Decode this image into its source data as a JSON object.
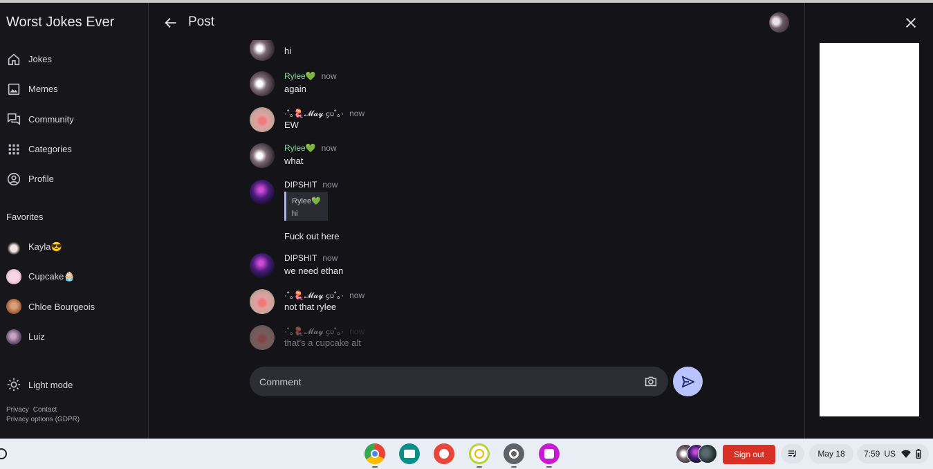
{
  "app_title": "Worst Jokes Ever",
  "nav": [
    {
      "label": "Jokes",
      "icon": "home-icon"
    },
    {
      "label": "Memes",
      "icon": "image-icon"
    },
    {
      "label": "Community",
      "icon": "forum-icon"
    },
    {
      "label": "Categories",
      "icon": "apps-grid-icon"
    },
    {
      "label": "Profile",
      "icon": "account-circle-icon"
    }
  ],
  "favorites_title": "Favorites",
  "favorites": [
    {
      "name": "Kayla😎"
    },
    {
      "name": "Cupcake🧁"
    },
    {
      "name": "Chloe Bourgeois"
    },
    {
      "name": "Luiz"
    }
  ],
  "light_mode_label": "Light mode",
  "footer": {
    "privacy": "Privacy",
    "contact": "Contact",
    "gdpr": "Privacy options (GDPR)"
  },
  "header": {
    "title": "Post"
  },
  "comments": [
    {
      "name": "",
      "time": "",
      "text": "hi"
    },
    {
      "name": "Rylee💚",
      "time": "now",
      "text": "again"
    },
    {
      "name": "·˚｡🪼𝓜𝓪𝔂 ᧔ᦢ˚｡·",
      "time": "now",
      "text": "EW"
    },
    {
      "name": "Rylee💚",
      "time": "now",
      "text": "what"
    },
    {
      "name": "DIPSHIT",
      "time": "now",
      "text": "Fuck out here",
      "quote_name": "Rylee💚",
      "quote_text": "hi"
    },
    {
      "name": "DIPSHIT",
      "time": "now",
      "text": "we need ethan"
    },
    {
      "name": "·˚｡🪼𝓜𝓪𝔂 ᧔ᦢ˚｡·",
      "time": "now",
      "text": "not that rylee"
    },
    {
      "name": "·˚｡🪼𝓜𝓪𝔂 ᧔ᦢ˚｡·",
      "time": "now",
      "text": "that's a cupcake alt"
    }
  ],
  "comment_input": {
    "placeholder": "Comment"
  },
  "taskbar": {
    "sign_out": "Sign out",
    "date": "May 18",
    "time": "7:59",
    "locale": "US"
  },
  "colors": {
    "accent": "#b9c3ff",
    "sign_out": "#d93025",
    "rylee_name": "#8ed2a2",
    "quote_bar": "#aab2ff"
  }
}
